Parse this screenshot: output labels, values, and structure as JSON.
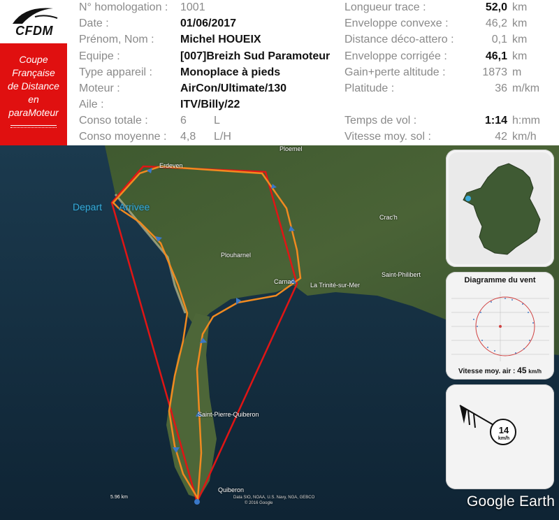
{
  "logo": {
    "text": "CFDM",
    "icon": "paraglider-swoosh-icon"
  },
  "event": {
    "line1": "Coupe",
    "line2": "Française",
    "line3": "de Distance",
    "line4": "en",
    "line5": "paraMoteur"
  },
  "info": {
    "homologation": {
      "label": "N° homologation :",
      "value": "1001"
    },
    "date": {
      "label": "Date :",
      "value": "01/06/2017"
    },
    "pilot": {
      "label": "Prénom, Nom :",
      "value": "Michel HOUEIX"
    },
    "team": {
      "label": "Equipe :",
      "value": "[007]Breizh Sud Paramoteur"
    },
    "aircraft_type": {
      "label": "Type appareil :",
      "value": "Monoplace à pieds"
    },
    "engine": {
      "label": "Moteur :",
      "value": "AirCon/Ultimate/130"
    },
    "wing": {
      "label": "Aile :",
      "value": "ITV/Billy/22"
    },
    "fuel_total": {
      "label": "Conso totale :",
      "value": "6",
      "unit": "L"
    },
    "fuel_avg": {
      "label": "Conso moyenne :",
      "value": "4,8",
      "unit": "L/H"
    }
  },
  "stats": {
    "track_length": {
      "label": "Longueur trace :",
      "value": "52,0",
      "unit": "km"
    },
    "convex_hull": {
      "label": "Enveloppe convexe :",
      "value": "46,2",
      "unit": "km"
    },
    "takeoff_landing": {
      "label": "Distance déco-attero :",
      "value": "0,1",
      "unit": "km"
    },
    "corrected_hull": {
      "label": "Enveloppe corrigée :",
      "value": "46,1",
      "unit": "km"
    },
    "altitude_gain": {
      "label": "Gain+perte altitude :",
      "value": "1873",
      "unit": "m"
    },
    "platitude": {
      "label": "Platitude :",
      "value": "36",
      "unit": "m/km"
    },
    "flight_time": {
      "label": "Temps de vol :",
      "value": "1:14",
      "unit": "h:mm"
    },
    "ground_speed": {
      "label": "Vitesse moy. sol :",
      "value": "42",
      "unit": "km/h"
    }
  },
  "map": {
    "start_label": "Depart",
    "end_label": "Arrivee",
    "places": {
      "erdeven": "Erdeven",
      "ploemel": "Ploemel",
      "crach": "Crac'h",
      "plouharnel": "Plouharnel",
      "carnac": "Carnac",
      "trinite": "La Trinité-sur-Mer",
      "saint_philibert": "Saint-Philibert",
      "saint_pierre": "Saint-Pierre-Quiberon",
      "quiberon": "Quiberon"
    },
    "scale": "5.96 km",
    "credits_line1": "Data SIO, NOAA, U.S. Navy, NGA, GEBCO",
    "credits_line2": "© 2016 Google",
    "colors": {
      "track": "#f08a20",
      "hull": "#e01515",
      "arrow": "#3a78c8"
    }
  },
  "wind_diagram": {
    "title": "Diagramme  du vent",
    "speed_label": "Vitesse moy. air :",
    "speed_value": "45",
    "speed_unit": "km/h"
  },
  "wind_indicator": {
    "value": "14",
    "unit": "km/h"
  },
  "branding": {
    "google_earth": "Google Earth"
  }
}
